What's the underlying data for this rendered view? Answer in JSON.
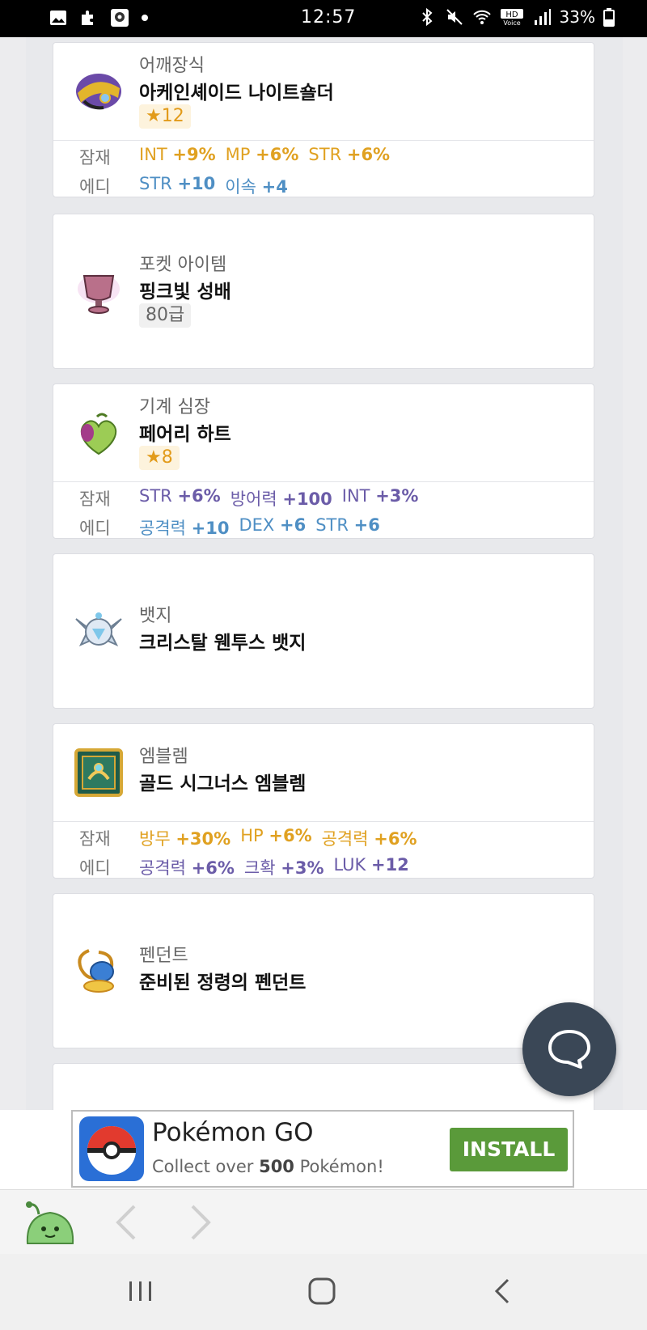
{
  "status_bar": {
    "time": "12:57",
    "battery": "33%"
  },
  "items": [
    {
      "type": "어깨장식",
      "name": "아케인셰이드 나이트숄더",
      "badge": "★12",
      "badge_kind": "star",
      "potential_label": "잠재",
      "potential": [
        {
          "stat": "INT",
          "val": "+9%"
        },
        {
          "stat": "MP",
          "val": "+6%"
        },
        {
          "stat": "STR",
          "val": "+6%"
        }
      ],
      "additional_label": "에디",
      "additional": [
        {
          "stat": "STR",
          "val": "+10"
        },
        {
          "stat": "이속",
          "val": "+4"
        }
      ]
    },
    {
      "type": "포켓 아이템",
      "name": "핑크빛 성배",
      "badge": "80급",
      "badge_kind": "level"
    },
    {
      "type": "기계 심장",
      "name": "페어리 하트",
      "badge": "★8",
      "badge_kind": "star",
      "potential_label": "잠재",
      "potential": [
        {
          "stat": "STR",
          "val": "+6%"
        },
        {
          "stat": "방어력",
          "val": "+100"
        },
        {
          "stat": "INT",
          "val": "+3%"
        }
      ],
      "additional_label": "에디",
      "additional": [
        {
          "stat": "공격력",
          "val": "+10"
        },
        {
          "stat": "DEX",
          "val": "+6"
        },
        {
          "stat": "STR",
          "val": "+6"
        }
      ]
    },
    {
      "type": "뱃지",
      "name": "크리스탈 웬투스 뱃지"
    },
    {
      "type": "엠블렘",
      "name": "골드 시그너스 엠블렘",
      "potential_label": "잠재",
      "potential": [
        {
          "stat": "방무",
          "val": "+30%"
        },
        {
          "stat": "HP",
          "val": "+6%"
        },
        {
          "stat": "공격력",
          "val": "+6%"
        }
      ],
      "additional_label": "에디",
      "additional": [
        {
          "stat": "공격력",
          "val": "+6%"
        },
        {
          "stat": "크확",
          "val": "+3%"
        },
        {
          "stat": "LUK",
          "val": "+12"
        }
      ]
    },
    {
      "type": "펜던트",
      "name": "준비된 정령의 펜던트"
    }
  ],
  "ad": {
    "title": "Pokémon GO",
    "sub_pre": "Collect over",
    "sub_num": "500",
    "sub_post": "Pokémon!",
    "cta": "INSTALL"
  }
}
